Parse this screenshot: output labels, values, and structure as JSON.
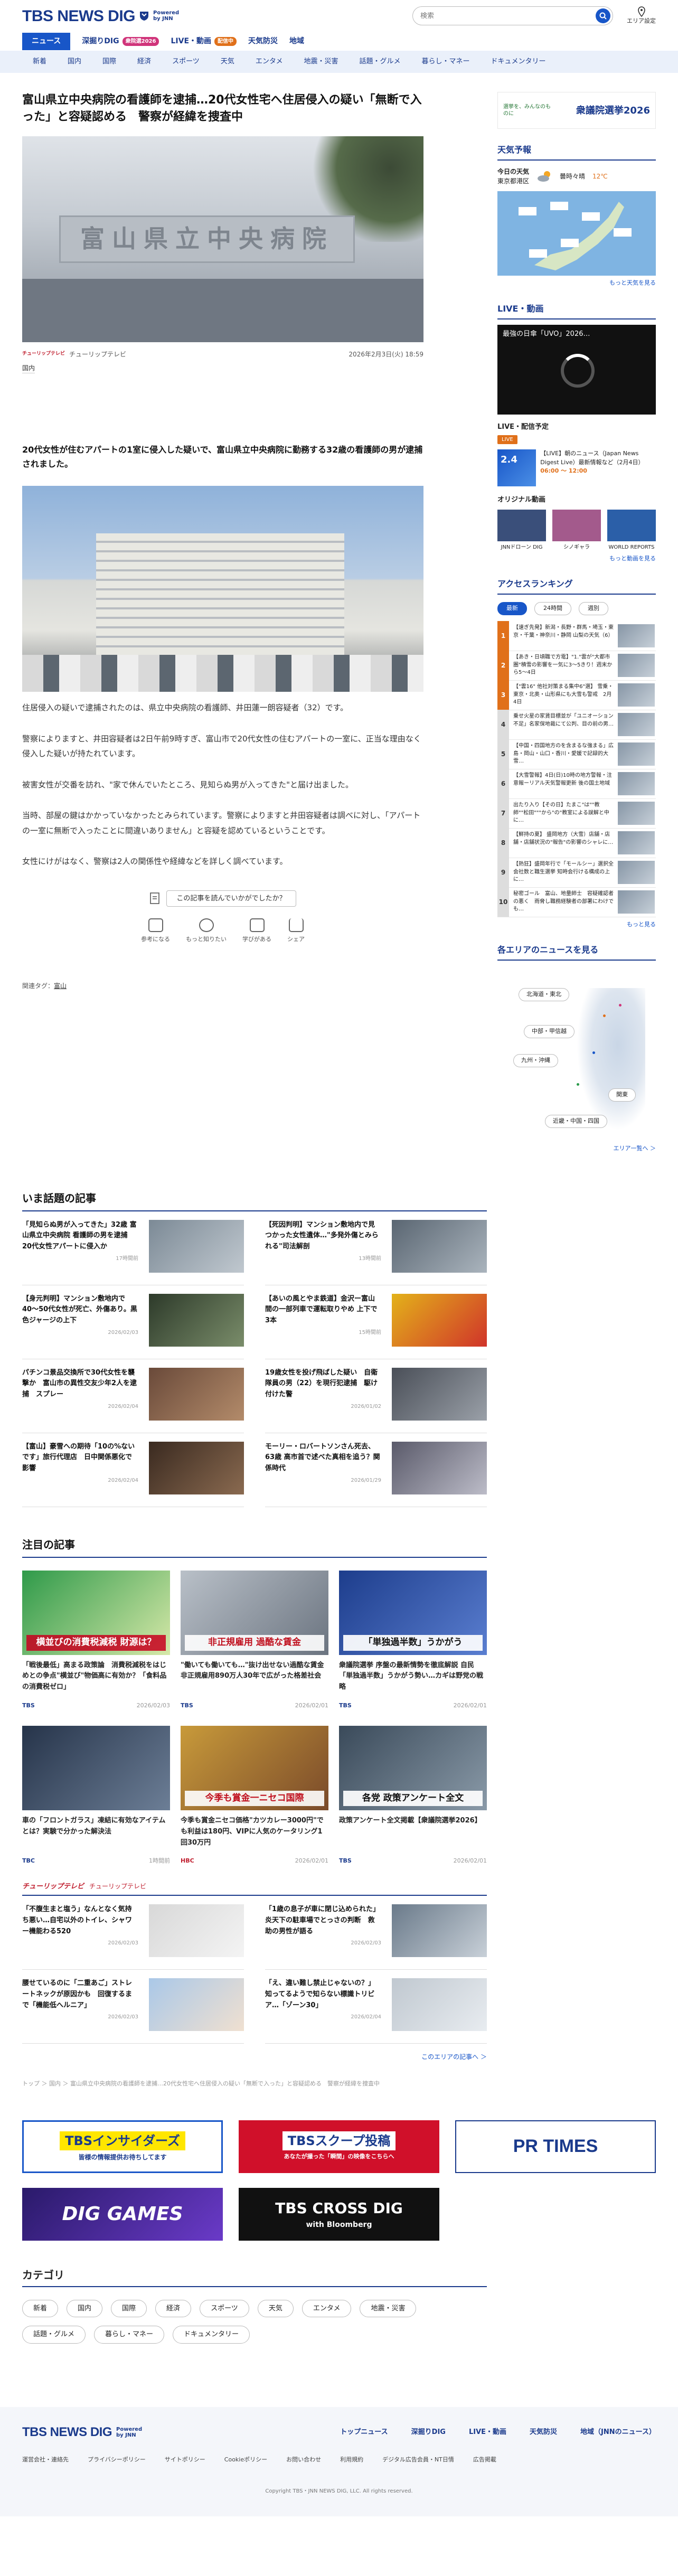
{
  "header": {
    "logo": "TBS NEWS DIG",
    "powered": "Powered by JNN",
    "search_placeholder": "検索",
    "area_label": "エリア設定"
  },
  "nav_main": [
    {
      "label": "ニュース",
      "badge": ""
    },
    {
      "label": "深掘りDIG",
      "badge": "衆院選2026"
    },
    {
      "label": "LIVE・動画",
      "badge": "配信中"
    },
    {
      "label": "天気防災",
      "badge": ""
    },
    {
      "label": "地域",
      "badge": ""
    }
  ],
  "nav_sub": [
    "新着",
    "国内",
    "国際",
    "経済",
    "スポーツ",
    "天気",
    "エンタメ",
    "地震・災害",
    "話題・グルメ",
    "暮らし・マネー",
    "ドキュメンタリー"
  ],
  "article": {
    "title": "富山県立中央病院の看護師を逮捕…20代女性宅へ住居侵入の疑い「無断で入った」と容疑認める　警察が経緯を捜査中",
    "hero_sign": "富山県立中央病院",
    "source": "チューリップテレビ",
    "source_logo": "チューリップテレビ",
    "date": "2026年2月3日(火) 18:59",
    "category": "国内",
    "lead": "20代女性が住むアパートの1室に侵入した疑いで、富山県立中央病院に勤務する32歳の看護師の男が逮捕されました。",
    "paragraphs": [
      "住居侵入の疑いで逮捕されたのは、県立中央病院の看護師、井田蓮一朗容疑者（32）です。",
      "警察によりますと、井田容疑者は2日午前9時すぎ、富山市で20代女性の住むアパートの一室に、正当な理由なく侵入した疑いが持たれています。",
      "被害女性が交番を訪れ、\"家で休んでいたところ、見知らぬ男が入ってきた\"と届け出ました。",
      "当時、部屋の鍵はかかっていなかったとみられています。警察によりますと井田容疑者は調べに対し、「アパートの一室に無断で入ったことに間違いありません」と容疑を認めているということです。",
      "女性にけがはなく、警察は2人の関係性や経緯などを詳しく調べています。"
    ],
    "feedback_q": "この記事を読んでいかがでしたか？",
    "feedback_btns": [
      "参考になる",
      "もっと知りたい",
      "学びがある",
      "シェア"
    ],
    "tags_label": "関連タグ：",
    "tag": "富山"
  },
  "trending": {
    "heading": "いま話題の記事",
    "items": [
      {
        "title": "「見知らぬ男が入ってきた」32歳 富山県立中央病院 看護師の男を逮捕　20代女性アパートに侵入か",
        "date": "17時間前"
      },
      {
        "title": "【死因判明】マンション敷地内で見つかった女性遺体…\"多発外傷とみられる\"司法解剖",
        "date": "13時間前"
      },
      {
        "title": "【身元判明】マンション敷地内で40〜50代女性が死亡、外傷あり。黒色ジャージの上下",
        "date": "2026/02/03"
      },
      {
        "title": "【あいの風とやま鉄道】金沢ー富山間の一部列車で運転取りやめ 上下で3本",
        "date": "15時間前"
      },
      {
        "title": "パチンコ景品交換所で30代女性を襲撃か　富山市の異性交友少年2人を逮捕　スプレー",
        "date": "2026/02/04"
      },
      {
        "title": "19歳女性を投げ飛ばした疑い　自衛隊員の男（22）を現行犯逮捕　駆け付けた警",
        "date": "2026/01/02"
      },
      {
        "title": "【富山】豪雪への期待「10の%ないです」旅行代理店　日中関係悪化で影響",
        "date": "2026/02/04"
      },
      {
        "title": "モーリー・ロバートソンさん死去、63歳 高市首で述べた真相を追う？関係時代",
        "date": "2026/01/29"
      }
    ]
  },
  "featured": {
    "heading": "注目の記事",
    "items": [
      {
        "image_caption": "横並びの消費税減税 財源は？",
        "title": "「戦後最低」高まる政策論　消費税減税をはじめとの争点\"横並び\"物価高に有効か？「食料品の消費税ゼロ」",
        "source": "TBS",
        "date": "2026/02/03"
      },
      {
        "image_caption": "非正規雇用 過酷な賃金",
        "title": "\"働いても働いても…\"抜け出せない過酷な賃金　非正規雇用890万人30年で広がった格差社会",
        "source": "TBS",
        "date": "2026/02/01"
      },
      {
        "image_caption": "「単独過半数」うかがう",
        "title": "衆議院選挙 序盤の最新情勢を徹底解説 自民「単独過半数」うかがう勢い…カギは野党の戦略",
        "source": "TBS",
        "date": "2026/02/01"
      },
      {
        "image_caption": "",
        "title": "車の「フロントガラス」凍結に有効なアイテムとは？実験で分かった解決法",
        "source": "TBC",
        "date": "1時間前"
      },
      {
        "image_caption": "今季も賞金一ニセコ国際",
        "title": "今季も賞金ニセコ価格\"カツカレー3000円\"でも利益は180円、VIPに人気のケータリング1回30万円",
        "source": "HBC",
        "date": "2026/02/01"
      },
      {
        "image_caption": "各党 政策アンケート全文",
        "title": "政策アンケート全文掲載【衆議院選挙2026】",
        "source": "TBS",
        "date": "2026/02/01"
      }
    ]
  },
  "tulip": {
    "logo": "チューリップテレビ",
    "name": "チューリップテレビ",
    "items": [
      {
        "title": "「不腹生まと塩う」なんとなく気持ち悪い…自宅以外のトイレ、シャワー機能わる520",
        "date": "2026/02/03"
      },
      {
        "title": "「1歳の息子が車に閉じ込められた」炎天下の駐車場でとっさの判断　救助の男性が語る",
        "date": "2026/02/03"
      },
      {
        "title": "腰せているのに「二重あご」ストレートネックが原因かも　回復するまで「機能低へルニア」",
        "date": "2026/02/03"
      },
      {
        "title": "「え、違い難し禁止じゃないの？」知ってるようで知らない標識トリビア…「ゾーン30」",
        "date": "2026/02/04"
      }
    ],
    "more": "このエリアの記事へ ＞"
  },
  "breadcrumb": "トップ ＞ 国内 ＞ 富山県立中央病院の看護師を逮捕…20代女性宅へ住居侵入の疑い「無断で入った」と容疑認める　警察が経緯を捜査中",
  "banners": [
    {
      "title": "TBSインサイダーズ",
      "sub": "皆様の情報提供お待ちしてます"
    },
    {
      "title": "TBSスクープ投稿",
      "sub": "あなたが撮った「瞬間」の映像をこちらへ"
    },
    {
      "title": "PR TIMES",
      "sub": ""
    },
    {
      "title": "DIG GAMES",
      "sub": ""
    },
    {
      "title": "TBS CROSS DIG",
      "sub": "with Bloomberg"
    }
  ],
  "categories": {
    "heading": "カテゴリ",
    "items": [
      "新着",
      "国内",
      "国際",
      "経済",
      "スポーツ",
      "天気",
      "エンタメ",
      "地震・災害",
      "話題・グルメ",
      "暮らし・マネー",
      "ドキュメンタリー"
    ]
  },
  "footer": {
    "logo": "TBS NEWS DIG",
    "powered": "Powered by JNN",
    "links": [
      "トップニュース",
      "深掘りDIG",
      "LIVE・動画",
      "天気防災",
      "地域（JNNのニュース）"
    ],
    "sub": [
      "運営会社・連絡先",
      "プライバシーポリシー",
      "サイトポリシー",
      "Cookieポリシー",
      "お問い合わせ",
      "利用規約",
      "デジタル広告会員・NT日情",
      "広告掲載"
    ],
    "copyright": "Copyright TBS・JNN NEWS DIG, LLC. All rights reserved."
  },
  "sidebar": {
    "election_banner_a": "選挙を、みんなのものに",
    "election_banner_b": "衆議院選挙2026",
    "weather_heading": "天気予報",
    "weather_day": "今日の天気",
    "weather_city": "東京都港区",
    "weather_desc": "曇時々晴",
    "weather_temp": "12℃",
    "weather_more": "もっと天気を見る",
    "live_heading": "LIVE・動画",
    "live_video_title": "最強の日傘「UVO」2026…",
    "live_sub": "LIVE・配信予定",
    "live_badge": "LIVE",
    "live_card_title": "【LIVE】朝のニュース（Japan News Digest Live）最新情報など（2月4日）",
    "live_card_time": "06:00 〜 12:00",
    "orig_heading": "オリジナル動画",
    "orig_items": [
      "JNNドローン DIG",
      "シノギャラ",
      "WORLD REPORTS"
    ],
    "live_more": "もっと動画を見る",
    "ranking_heading": "アクセスランキング",
    "ranking_tabs": [
      "最新",
      "24時間",
      "週別"
    ],
    "ranking": [
      "【速ぎ先発】新潟・長野・群馬・埼玉・東京・千葉・神奈川・静岡 山梨の天気（6）",
      "【あき・日頃職で方電】\"1.\"雲が\"大都市圏\"積雪の影響を一気に3～5きり！週末から5～4日",
      "【\"雲16\" 他社対策まる集中6\"選】 雪乗・東京・北奥・山形県にも大雪も警戒　2月4日",
      "乗せ火星の家賃目標並が「ユニオーション不足」名家保地裁にて公判、目の前の男…",
      "【中国・四国地方のを含まるな強まる」広島・岡山・山口・香川・愛媛で記録的大雪…",
      "【大雪警報】4日(日)10時の地方警報・注意報ーリアル天気警報更新 後の国土地域",
      "出たり入り【その日】たまこ\"は\"\"教師\"\"松田\"\"\"から\"の\"教室による誤解と中に…",
      "【鮮持の夏】 盛岡地方（大雪）店舗・店舗・店舗状況の\"報告\"の影響のシャレに…",
      "【熱狂】盛岡年行で「モールシー」選択全会社数と職生選挙 知時会行ける構成の上に…",
      "秘密ゴール　富山、地量師士　容疑確認者の悪く　雨脅し職務経験者の部署にわけでも…"
    ],
    "ranking_more": "もっと見る",
    "area_heading": "各エリアのニュースを見る",
    "areas": [
      "北海道・東北",
      "中部・甲信越",
      "九州・沖縄",
      "関東",
      "近畿・中国・四国"
    ],
    "area_more": "エリア一覧へ ＞"
  }
}
